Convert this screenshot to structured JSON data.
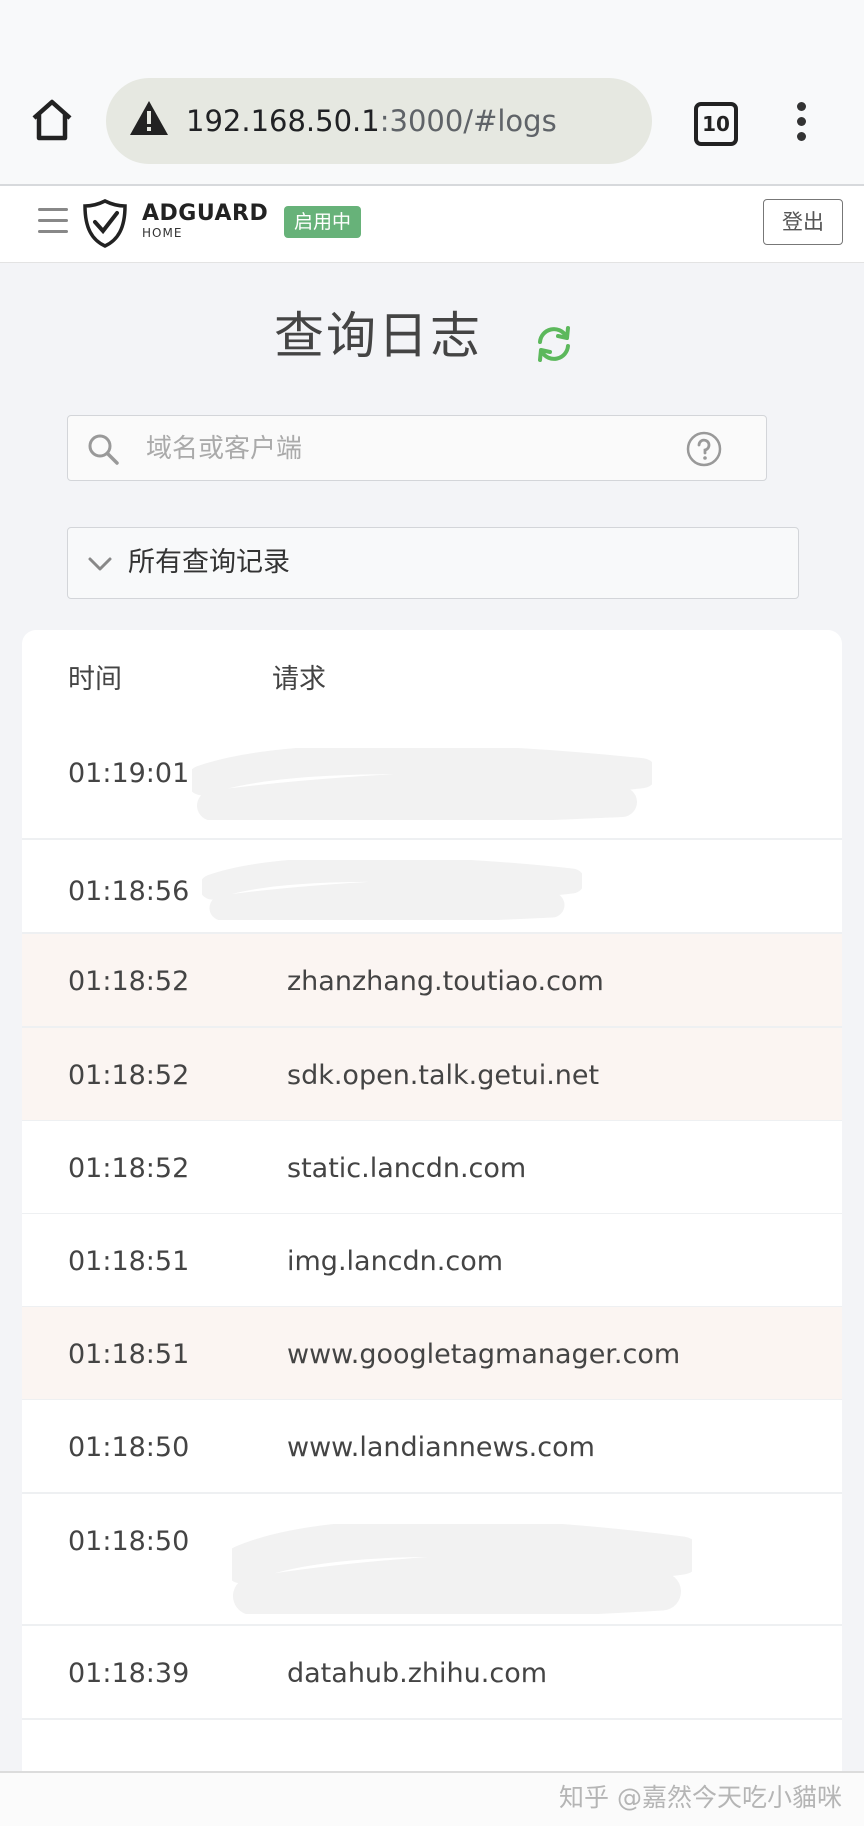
{
  "browser": {
    "url_host": "192.168.50.1",
    "url_rest": ":3000/#logs",
    "tab_count": "10"
  },
  "app": {
    "logo_main": "ADGUARD",
    "logo_sub": "HOME",
    "status_badge": "启用中",
    "logout_label": "登出"
  },
  "page": {
    "title": "查询日志"
  },
  "search": {
    "placeholder": "域名或客户端"
  },
  "filter": {
    "selected": "所有查询记录"
  },
  "table": {
    "headers": {
      "time": "时间",
      "request": "请求"
    },
    "rows": [
      {
        "time": "01:19:01",
        "domain": "",
        "blocked": false
      },
      {
        "time": "01:18:56",
        "domain": "",
        "blocked": false
      },
      {
        "time": "01:18:52",
        "domain": "zhanzhang.toutiao.com",
        "blocked": true
      },
      {
        "time": "01:18:52",
        "domain": "sdk.open.talk.getui.net",
        "blocked": true
      },
      {
        "time": "01:18:52",
        "domain": "static.lancdn.com",
        "blocked": false
      },
      {
        "time": "01:18:51",
        "domain": "img.lancdn.com",
        "blocked": false
      },
      {
        "time": "01:18:51",
        "domain": "www.googletagmanager.com",
        "blocked": true
      },
      {
        "time": "01:18:50",
        "domain": "www.landiannews.com",
        "blocked": false
      },
      {
        "time": "01:18:50",
        "domain": "",
        "blocked": false
      },
      {
        "time": "01:18:39",
        "domain": "datahub.zhihu.com",
        "blocked": false
      }
    ]
  },
  "watermark": "知乎 @嘉然今天吃小貓咪",
  "colors": {
    "accent_green": "#67b279",
    "blocked_row": "#fbf5f2",
    "refresh_green": "#5cb85c"
  }
}
